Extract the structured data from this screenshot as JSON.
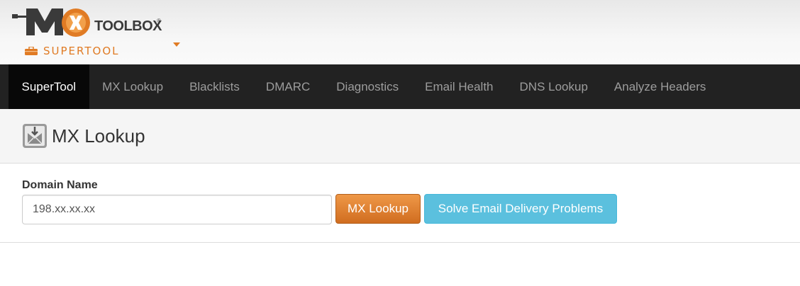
{
  "header": {
    "logo_toolbox": "TOOLBOX",
    "logo_reg": "®",
    "supertool_label": "SUPERTOOL",
    "brand_color": "#e07b24"
  },
  "nav": {
    "items": [
      {
        "label": "SuperTool",
        "active": true
      },
      {
        "label": "MX Lookup",
        "active": false
      },
      {
        "label": "Blacklists",
        "active": false
      },
      {
        "label": "DMARC",
        "active": false
      },
      {
        "label": "Diagnostics",
        "active": false
      },
      {
        "label": "Email Health",
        "active": false
      },
      {
        "label": "DNS Lookup",
        "active": false
      },
      {
        "label": "Analyze Headers",
        "active": false
      }
    ]
  },
  "page": {
    "title": "MX Lookup",
    "icon": "envelope-download-icon"
  },
  "form": {
    "domain_label": "Domain Name",
    "domain_value": "198.xx.xx.xx",
    "mx_lookup_button": "MX Lookup",
    "solve_button": "Solve Email Delivery Problems"
  }
}
